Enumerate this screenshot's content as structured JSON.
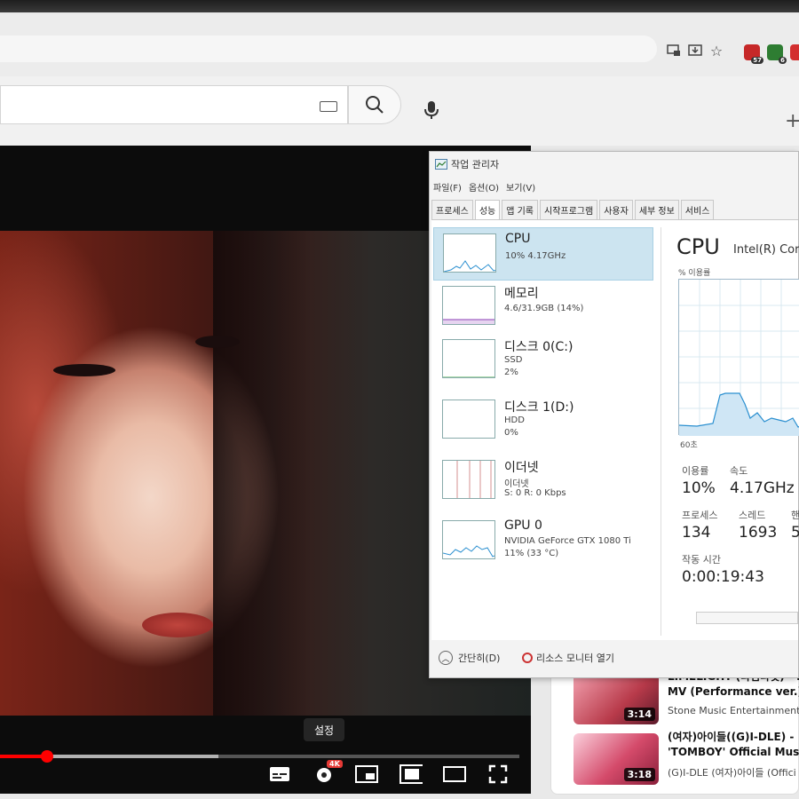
{
  "browser": {
    "extensions": [
      {
        "name": "shield-ext",
        "badge": "57",
        "color": "#c62828"
      },
      {
        "name": "check-ext",
        "badge": "6",
        "color": "#2e7d32"
      },
      {
        "name": "red-ext",
        "badge": "",
        "color": "#d32f2f"
      }
    ]
  },
  "player": {
    "tooltip": "설정",
    "settings_badge": "4K",
    "progress_played": 0.09,
    "progress_loaded": 0.42
  },
  "recommendations": [
    {
      "title_line1": "LIMELIGHT (라임라잇) - L",
      "title_line2": "MV (Performance ver.)",
      "channel": "Stone Music Entertainment",
      "duration": "3:14",
      "thumb_color": "#b83a4a"
    },
    {
      "title_line1": "(여자)아이들((G)I-DLE) -",
      "title_line2": "'TOMBOY' Official Music",
      "channel": "(G)I-DLE (여자)아이들 (Offici",
      "duration": "3:18",
      "thumb_color": "#d44a6a"
    }
  ],
  "taskmanager": {
    "title": "작업 관리자",
    "menu": [
      "파일(F)",
      "옵션(O)",
      "보기(V)"
    ],
    "tabs": [
      "프로세스",
      "성능",
      "앱 기록",
      "시작프로그램",
      "사용자",
      "세부 정보",
      "서비스"
    ],
    "active_tab": "성능",
    "resources": [
      {
        "name": "CPU",
        "sub1": "10% 4.17GHz",
        "sub2": ""
      },
      {
        "name": "메모리",
        "sub1": "4.6/31.9GB (14%)",
        "sub2": ""
      },
      {
        "name": "디스크 0(C:)",
        "sub1": "SSD",
        "sub2": "2%"
      },
      {
        "name": "디스크 1(D:)",
        "sub1": "HDD",
        "sub2": "0%"
      },
      {
        "name": "이더넷",
        "sub1": "이더넷",
        "sub2": "S: 0 R: 0 Kbps"
      },
      {
        "name": "GPU 0",
        "sub1": "NVIDIA GeForce GTX 1080 Ti",
        "sub2": "11% (33 °C)"
      }
    ],
    "detail": {
      "heading": "CPU",
      "model": "Intel(R) Cor",
      "util_label": "% 이용률",
      "seconds_label": "60초",
      "stats": {
        "util_label": "이용률",
        "util_value": "10%",
        "speed_label": "속도",
        "speed_value": "4.17GHz",
        "proc_label": "프로세스",
        "proc_value": "134",
        "thread_label": "스레드",
        "thread_value": "1693",
        "handle_label": "핸",
        "handle_value": "5",
        "uptime_label": "작동 시간",
        "uptime_value": "0:00:19:43"
      }
    },
    "footer": {
      "fewer": "간단히(D)",
      "resmon": "리소스 모니터 열기"
    }
  }
}
